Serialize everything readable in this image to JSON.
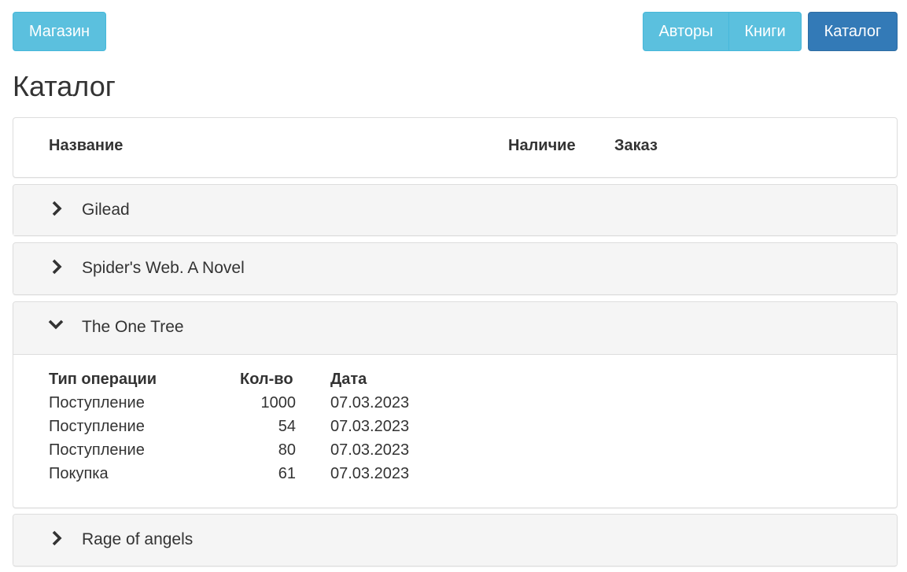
{
  "nav": {
    "shop_label": "Магазин",
    "authors_label": "Авторы",
    "books_label": "Книги",
    "catalog_label": "Каталог"
  },
  "page_title": "Каталог",
  "table_header": {
    "name": "Название",
    "stock": "Наличие",
    "order": "Заказ"
  },
  "books": [
    {
      "title": "Gilead",
      "expanded": false
    },
    {
      "title": "Spider's Web. A Novel",
      "expanded": false
    },
    {
      "title": "The One Tree",
      "expanded": true,
      "operations": {
        "headers": {
          "type": "Тип операции",
          "qty": "Кол-во",
          "date": "Дата"
        },
        "rows": [
          {
            "type": "Поступление",
            "qty": "1000",
            "date": "07.03.2023"
          },
          {
            "type": "Поступление",
            "qty": "54",
            "date": "07.03.2023"
          },
          {
            "type": "Поступление",
            "qty": "80",
            "date": "07.03.2023"
          },
          {
            "type": "Покупка",
            "qty": "61",
            "date": "07.03.2023"
          }
        ]
      }
    },
    {
      "title": "Rage of angels",
      "expanded": false
    }
  ],
  "colors": {
    "info_button": "#5bc0de",
    "primary_button": "#337ab7",
    "panel_heading": "#f5f5f5"
  },
  "icons": {
    "collapsed": "chevron-right-icon",
    "expanded": "chevron-down-icon"
  }
}
